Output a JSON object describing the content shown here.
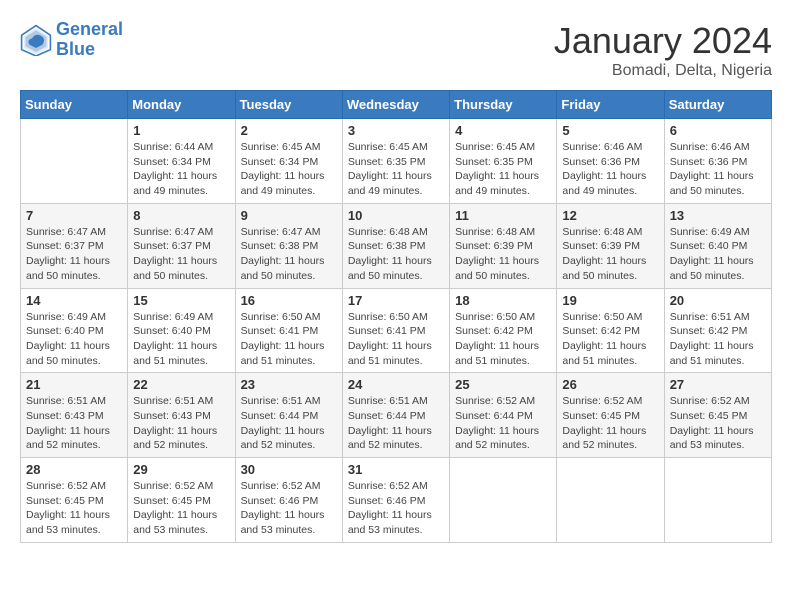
{
  "header": {
    "logo_line1": "General",
    "logo_line2": "Blue",
    "month_title": "January 2024",
    "location": "Bomadi, Delta, Nigeria"
  },
  "days_of_week": [
    "Sunday",
    "Monday",
    "Tuesday",
    "Wednesday",
    "Thursday",
    "Friday",
    "Saturday"
  ],
  "weeks": [
    [
      {
        "day": "",
        "sunrise": "",
        "sunset": "",
        "daylight": ""
      },
      {
        "day": "1",
        "sunrise": "Sunrise: 6:44 AM",
        "sunset": "Sunset: 6:34 PM",
        "daylight": "Daylight: 11 hours and 49 minutes."
      },
      {
        "day": "2",
        "sunrise": "Sunrise: 6:45 AM",
        "sunset": "Sunset: 6:34 PM",
        "daylight": "Daylight: 11 hours and 49 minutes."
      },
      {
        "day": "3",
        "sunrise": "Sunrise: 6:45 AM",
        "sunset": "Sunset: 6:35 PM",
        "daylight": "Daylight: 11 hours and 49 minutes."
      },
      {
        "day": "4",
        "sunrise": "Sunrise: 6:45 AM",
        "sunset": "Sunset: 6:35 PM",
        "daylight": "Daylight: 11 hours and 49 minutes."
      },
      {
        "day": "5",
        "sunrise": "Sunrise: 6:46 AM",
        "sunset": "Sunset: 6:36 PM",
        "daylight": "Daylight: 11 hours and 49 minutes."
      },
      {
        "day": "6",
        "sunrise": "Sunrise: 6:46 AM",
        "sunset": "Sunset: 6:36 PM",
        "daylight": "Daylight: 11 hours and 50 minutes."
      }
    ],
    [
      {
        "day": "7",
        "sunrise": "Sunrise: 6:47 AM",
        "sunset": "Sunset: 6:37 PM",
        "daylight": "Daylight: 11 hours and 50 minutes."
      },
      {
        "day": "8",
        "sunrise": "Sunrise: 6:47 AM",
        "sunset": "Sunset: 6:37 PM",
        "daylight": "Daylight: 11 hours and 50 minutes."
      },
      {
        "day": "9",
        "sunrise": "Sunrise: 6:47 AM",
        "sunset": "Sunset: 6:38 PM",
        "daylight": "Daylight: 11 hours and 50 minutes."
      },
      {
        "day": "10",
        "sunrise": "Sunrise: 6:48 AM",
        "sunset": "Sunset: 6:38 PM",
        "daylight": "Daylight: 11 hours and 50 minutes."
      },
      {
        "day": "11",
        "sunrise": "Sunrise: 6:48 AM",
        "sunset": "Sunset: 6:39 PM",
        "daylight": "Daylight: 11 hours and 50 minutes."
      },
      {
        "day": "12",
        "sunrise": "Sunrise: 6:48 AM",
        "sunset": "Sunset: 6:39 PM",
        "daylight": "Daylight: 11 hours and 50 minutes."
      },
      {
        "day": "13",
        "sunrise": "Sunrise: 6:49 AM",
        "sunset": "Sunset: 6:40 PM",
        "daylight": "Daylight: 11 hours and 50 minutes."
      }
    ],
    [
      {
        "day": "14",
        "sunrise": "Sunrise: 6:49 AM",
        "sunset": "Sunset: 6:40 PM",
        "daylight": "Daylight: 11 hours and 50 minutes."
      },
      {
        "day": "15",
        "sunrise": "Sunrise: 6:49 AM",
        "sunset": "Sunset: 6:40 PM",
        "daylight": "Daylight: 11 hours and 51 minutes."
      },
      {
        "day": "16",
        "sunrise": "Sunrise: 6:50 AM",
        "sunset": "Sunset: 6:41 PM",
        "daylight": "Daylight: 11 hours and 51 minutes."
      },
      {
        "day": "17",
        "sunrise": "Sunrise: 6:50 AM",
        "sunset": "Sunset: 6:41 PM",
        "daylight": "Daylight: 11 hours and 51 minutes."
      },
      {
        "day": "18",
        "sunrise": "Sunrise: 6:50 AM",
        "sunset": "Sunset: 6:42 PM",
        "daylight": "Daylight: 11 hours and 51 minutes."
      },
      {
        "day": "19",
        "sunrise": "Sunrise: 6:50 AM",
        "sunset": "Sunset: 6:42 PM",
        "daylight": "Daylight: 11 hours and 51 minutes."
      },
      {
        "day": "20",
        "sunrise": "Sunrise: 6:51 AM",
        "sunset": "Sunset: 6:42 PM",
        "daylight": "Daylight: 11 hours and 51 minutes."
      }
    ],
    [
      {
        "day": "21",
        "sunrise": "Sunrise: 6:51 AM",
        "sunset": "Sunset: 6:43 PM",
        "daylight": "Daylight: 11 hours and 52 minutes."
      },
      {
        "day": "22",
        "sunrise": "Sunrise: 6:51 AM",
        "sunset": "Sunset: 6:43 PM",
        "daylight": "Daylight: 11 hours and 52 minutes."
      },
      {
        "day": "23",
        "sunrise": "Sunrise: 6:51 AM",
        "sunset": "Sunset: 6:44 PM",
        "daylight": "Daylight: 11 hours and 52 minutes."
      },
      {
        "day": "24",
        "sunrise": "Sunrise: 6:51 AM",
        "sunset": "Sunset: 6:44 PM",
        "daylight": "Daylight: 11 hours and 52 minutes."
      },
      {
        "day": "25",
        "sunrise": "Sunrise: 6:52 AM",
        "sunset": "Sunset: 6:44 PM",
        "daylight": "Daylight: 11 hours and 52 minutes."
      },
      {
        "day": "26",
        "sunrise": "Sunrise: 6:52 AM",
        "sunset": "Sunset: 6:45 PM",
        "daylight": "Daylight: 11 hours and 52 minutes."
      },
      {
        "day": "27",
        "sunrise": "Sunrise: 6:52 AM",
        "sunset": "Sunset: 6:45 PM",
        "daylight": "Daylight: 11 hours and 53 minutes."
      }
    ],
    [
      {
        "day": "28",
        "sunrise": "Sunrise: 6:52 AM",
        "sunset": "Sunset: 6:45 PM",
        "daylight": "Daylight: 11 hours and 53 minutes."
      },
      {
        "day": "29",
        "sunrise": "Sunrise: 6:52 AM",
        "sunset": "Sunset: 6:45 PM",
        "daylight": "Daylight: 11 hours and 53 minutes."
      },
      {
        "day": "30",
        "sunrise": "Sunrise: 6:52 AM",
        "sunset": "Sunset: 6:46 PM",
        "daylight": "Daylight: 11 hours and 53 minutes."
      },
      {
        "day": "31",
        "sunrise": "Sunrise: 6:52 AM",
        "sunset": "Sunset: 6:46 PM",
        "daylight": "Daylight: 11 hours and 53 minutes."
      },
      {
        "day": "",
        "sunrise": "",
        "sunset": "",
        "daylight": ""
      },
      {
        "day": "",
        "sunrise": "",
        "sunset": "",
        "daylight": ""
      },
      {
        "day": "",
        "sunrise": "",
        "sunset": "",
        "daylight": ""
      }
    ]
  ]
}
